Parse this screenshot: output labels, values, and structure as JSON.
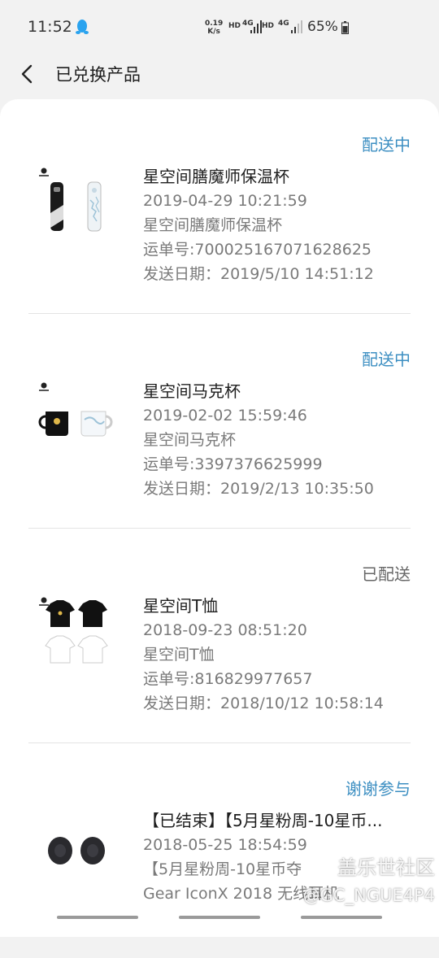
{
  "status_bar": {
    "time": "11:52",
    "speed_value": "0.19",
    "speed_unit": "K/s",
    "hd1": "HD",
    "net1": "4G",
    "hd2": "HD",
    "net2": "4G",
    "battery": "65%"
  },
  "header": {
    "title": "已兑换产品"
  },
  "orders": [
    {
      "status": "配送中",
      "name": "星空间膳魔师保温杯",
      "date": "2019-04-29 10:21:59",
      "sub": "星空间膳魔师保温杯",
      "tracking": "运单号:700025167071628625",
      "ship": "发送日期：2019/5/10 14:51:12"
    },
    {
      "status": "配送中",
      "name": "星空间马克杯",
      "date": "2019-02-02 15:59:46",
      "sub": "星空间马克杯",
      "tracking": "运单号:3397376625999",
      "ship": "发送日期：2019/2/13 10:35:50"
    },
    {
      "status": "已配送",
      "name": "星空间T恤",
      "date": "2018-09-23 08:51:20",
      "sub": "星空间T恤",
      "tracking": "运单号:816829977657",
      "ship": "发送日期：2018/10/12 10:58:14"
    },
    {
      "status": "谢谢参与",
      "name": "【已结束】【5月星粉周-10星币...",
      "date": "2018-05-25 18:54:59",
      "sub": "【5月星粉周-10星币夺",
      "tracking": "Gear IconX 2018 无线耳机"
    }
  ],
  "watermark": {
    "site": "盖乐世社区",
    "user": "@GC_NGUE4P4"
  },
  "colors": {
    "status_active": "#3d8fc2",
    "status_done": "#666666",
    "card_bg": "#ffffff",
    "page_bg": "#f2f2f2"
  }
}
